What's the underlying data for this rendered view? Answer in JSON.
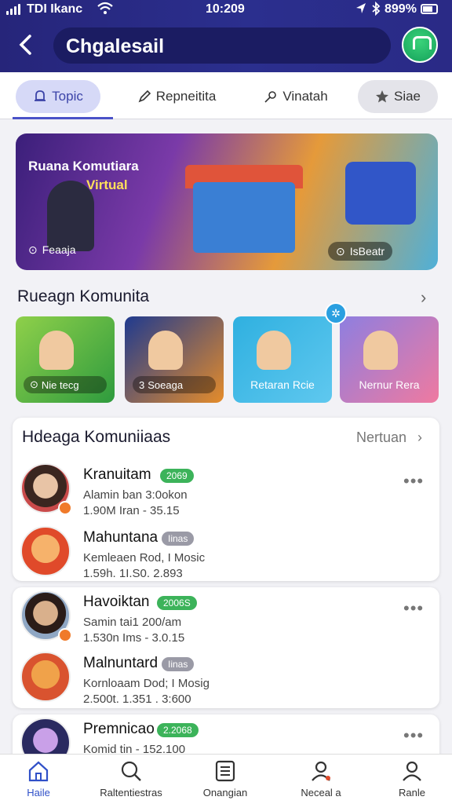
{
  "status_bar": {
    "carrier": "TDI Ikanc",
    "time": "10:209",
    "battery": "899%"
  },
  "header": {
    "title": "Chgalesail"
  },
  "tabs": [
    {
      "label": "Topic",
      "active": true
    },
    {
      "label": "Repneitita"
    },
    {
      "label": "Vinatah"
    },
    {
      "label": "Siae"
    }
  ],
  "banner": {
    "title_line1": "Ruana Komutiara",
    "title_line2": "Virtual",
    "left_label": "Feaaja",
    "right_label": "IsBeatr"
  },
  "section_community": {
    "title": "Rueagn Komunita",
    "cards": [
      {
        "label": "Nie tecg"
      },
      {
        "label": "Soeaga"
      },
      {
        "label": "Retaran Rcie"
      },
      {
        "label": "Nernur Rera"
      }
    ]
  },
  "section_list": {
    "title": "Hdeaga Komuniiaas",
    "more_label": "Nertuan",
    "items": [
      {
        "name": "Kranuitam",
        "badge": "2069",
        "line1": "Alamin ban 3:0okon",
        "line2": "1.90M Iran - 35.15"
      },
      {
        "name": "Mahuntana",
        "badge": "Iinas",
        "line1": "Kemleaen Rod, I Mosic",
        "line2": "1.59h. 1I.S0. 2.893"
      },
      {
        "name": "Havoiktan",
        "badge": "2006S",
        "line1": "Samin tai1 200/am",
        "line2": "1.530n Ims - 3.0.15"
      },
      {
        "name": "Malnuntard",
        "badge": "Iinas",
        "line1": "Kornloaam Dod; I Mosig",
        "line2": "2.500t. 1.351 . 3:600"
      },
      {
        "name": "Premnicao",
        "badge": "2.2068",
        "line1": "Komid tin - 152.100",
        "line2": ""
      }
    ]
  },
  "bottom_nav": [
    {
      "label": "Haile",
      "active": true
    },
    {
      "label": "Raltentiestras"
    },
    {
      "label": "Onangian"
    },
    {
      "label": "Neceal a"
    },
    {
      "label": "Ranle"
    }
  ]
}
